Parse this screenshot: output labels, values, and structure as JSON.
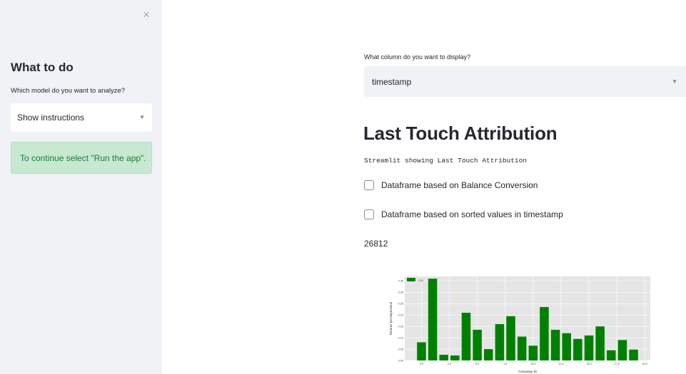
{
  "sidebar": {
    "close_glyph": "×",
    "title": "What to do",
    "model_label": "Which model do you want to analyze?",
    "model_select": {
      "value": "Show instructions"
    },
    "alert": "To continue select \"Run the app\"."
  },
  "main": {
    "column_label": "What column do you want to display?",
    "column_select": {
      "value": "timestamp"
    },
    "title": "Last Touch Attribution",
    "subtitle": "Streamlit showing Last Touch Attribution",
    "checkboxes": [
      {
        "label": "Dataframe based on Balance Conversion",
        "checked": false
      },
      {
        "label": "Dataframe based on sorted values in timestamp",
        "checked": false
      }
    ],
    "metric": "26812"
  },
  "colors": {
    "sidebar_bg": "#f0f2f6",
    "alert_bg": "#c7e8d1",
    "alert_text": "#1e7a3a",
    "bar": "#008000",
    "plot_bg": "#e5e5e5"
  },
  "icons": {
    "close": "close-icon",
    "dropdown": "chevron-down-icon"
  },
  "chart_data": {
    "type": "bar",
    "title": "",
    "xlabel": "Campaign ID",
    "ylabel": "Returns per impression",
    "legend": [
      "LTA"
    ],
    "legend_position": "top-left",
    "grid": true,
    "x": [
      0,
      1,
      2,
      3,
      4,
      5,
      6,
      7,
      8,
      9,
      10,
      11,
      12,
      13,
      14,
      15,
      16,
      17,
      18,
      19
    ],
    "values": [
      0.08,
      0.36,
      0.025,
      0.022,
      0.21,
      0.135,
      0.05,
      0.16,
      0.195,
      0.105,
      0.065,
      0.235,
      0.135,
      0.12,
      0.095,
      0.11,
      0.15,
      0.045,
      0.09,
      0.048
    ],
    "xticks": [
      "0.0",
      "2.5",
      "5.0",
      "7.5",
      "10.0",
      "12.5",
      "15.0",
      "17.5",
      "20.0"
    ],
    "xtick_values": [
      0,
      2.5,
      5,
      7.5,
      10,
      12.5,
      15,
      17.5,
      20
    ],
    "yticks": [
      "0.00",
      "0.05",
      "0.10",
      "0.15",
      "0.20",
      "0.25",
      "0.30",
      "0.35"
    ],
    "ytick_values": [
      0,
      0.05,
      0.1,
      0.15,
      0.2,
      0.25,
      0.3,
      0.35
    ],
    "xlim": [
      -1.5,
      20.5
    ],
    "ylim": [
      0,
      0.37
    ]
  }
}
